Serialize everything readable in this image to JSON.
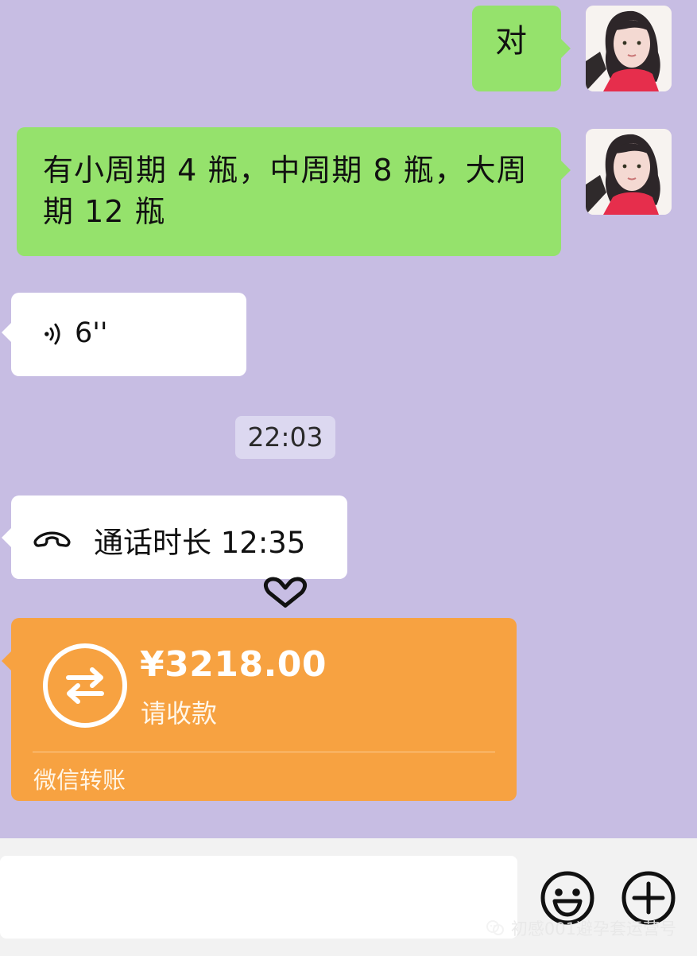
{
  "chat": {
    "messages": [
      {
        "type": "text",
        "text": "对"
      },
      {
        "type": "text",
        "text": "有小周期 4 瓶，中周期 8 瓶，大周期 12 瓶"
      },
      {
        "type": "voice",
        "duration": "6''"
      },
      {
        "type": "timestamp",
        "text": "22:03"
      },
      {
        "type": "call",
        "text": "通话时长 12:35"
      },
      {
        "type": "transfer",
        "amount": "¥3218.00",
        "subtitle": "请收款",
        "footer": "微信转账"
      }
    ]
  },
  "watermark": {
    "text": "初感001避孕套运营号"
  },
  "colors": {
    "background": "#c7bde3",
    "green_bubble": "#95e26c",
    "white_bubble": "#ffffff",
    "timestamp_bg": "#dcd8f0",
    "transfer_bg": "#f7a241"
  },
  "icons": {
    "voice": "voice-icon",
    "call": "phone-icon",
    "transfer": "transfer-icon",
    "emoji": "smile-icon",
    "plus": "plus-icon",
    "watermark": "wechat-official-icon"
  }
}
